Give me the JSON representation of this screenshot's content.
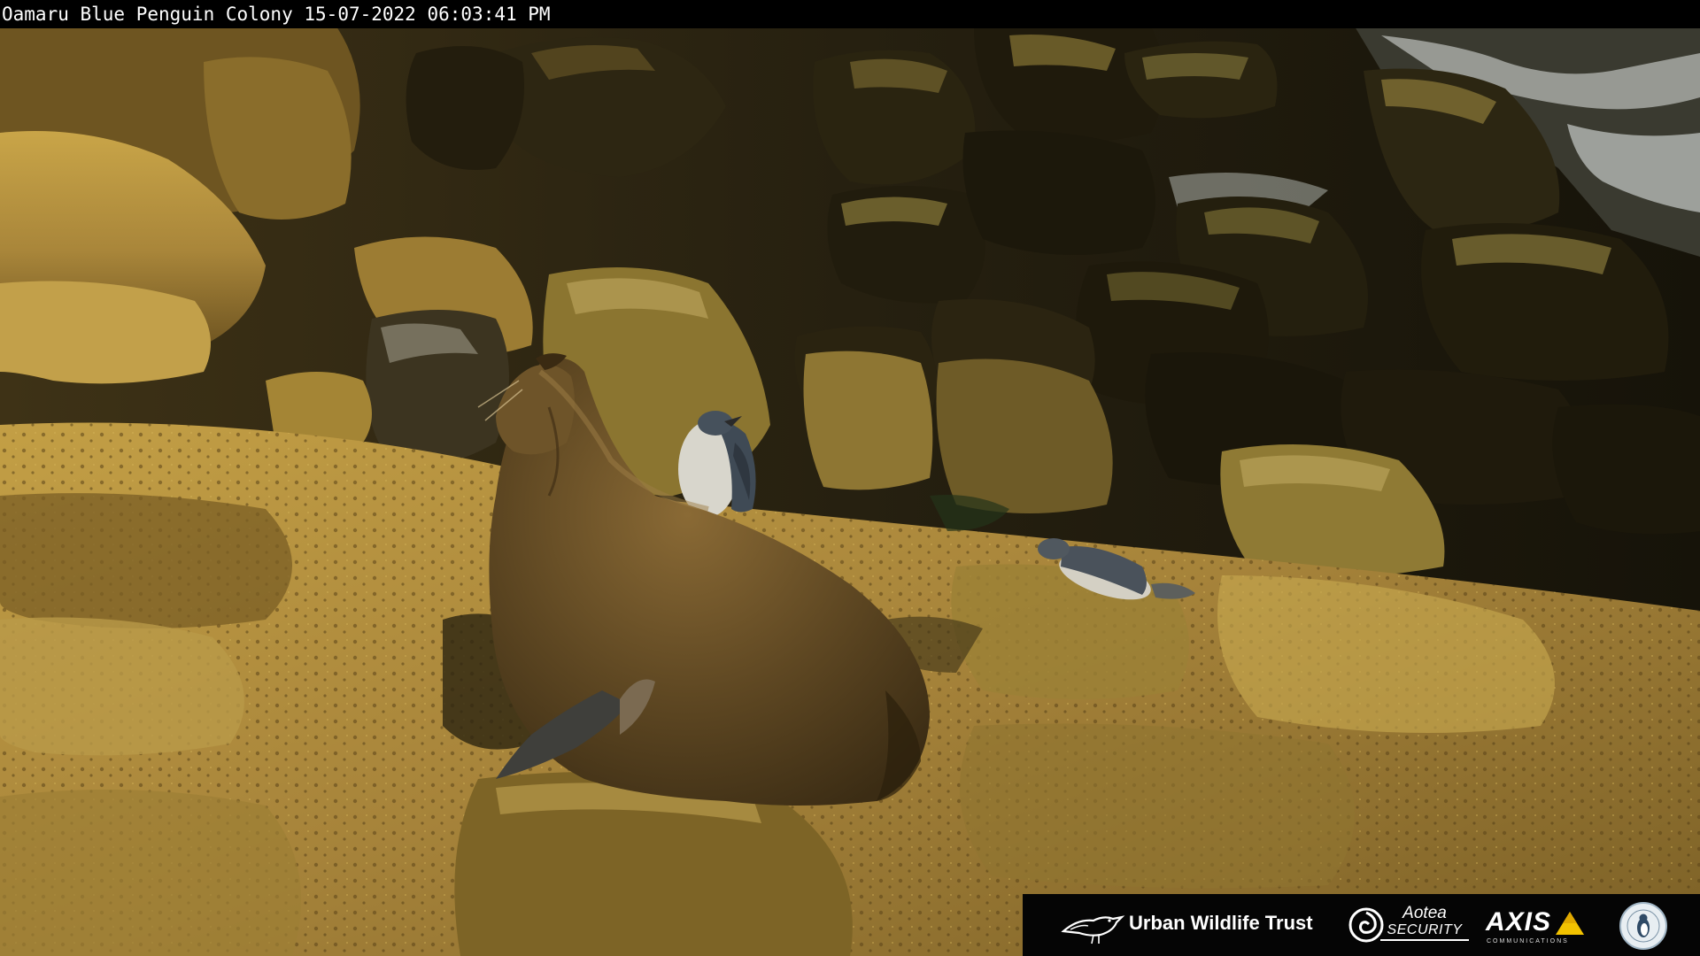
{
  "camera": {
    "location": "Oamaru Blue Penguin Colony",
    "date": "15-07-2022",
    "time": "06:03:41 PM"
  },
  "scene": {
    "subjects": [
      "fur-seal",
      "penguin-left",
      "penguin-right"
    ],
    "colors": {
      "rock_lit": "#b8943c",
      "rock_mid": "#7d6424",
      "rock_dark": "#241d0d",
      "seal_fur": "#5a4521",
      "seal_highlight": "#8a6a35",
      "penguin_white": "#d8d6cc",
      "penguin_blue": "#3f4a55",
      "surf": "#e8ecec"
    }
  },
  "sponsors": {
    "urban_wildlife_trust": {
      "label": "Urban Wildlife Trust",
      "icon": "bird-icon"
    },
    "aotea_security": {
      "word": "Aotea",
      "sub": "SECURITY",
      "icon": "aotea-swirl-icon"
    },
    "axis": {
      "word": "AXIS",
      "sub": "COMMUNICATIONS",
      "icon": "axis-triangle-icon"
    },
    "colony": {
      "icon": "colony-seal-icon"
    }
  }
}
